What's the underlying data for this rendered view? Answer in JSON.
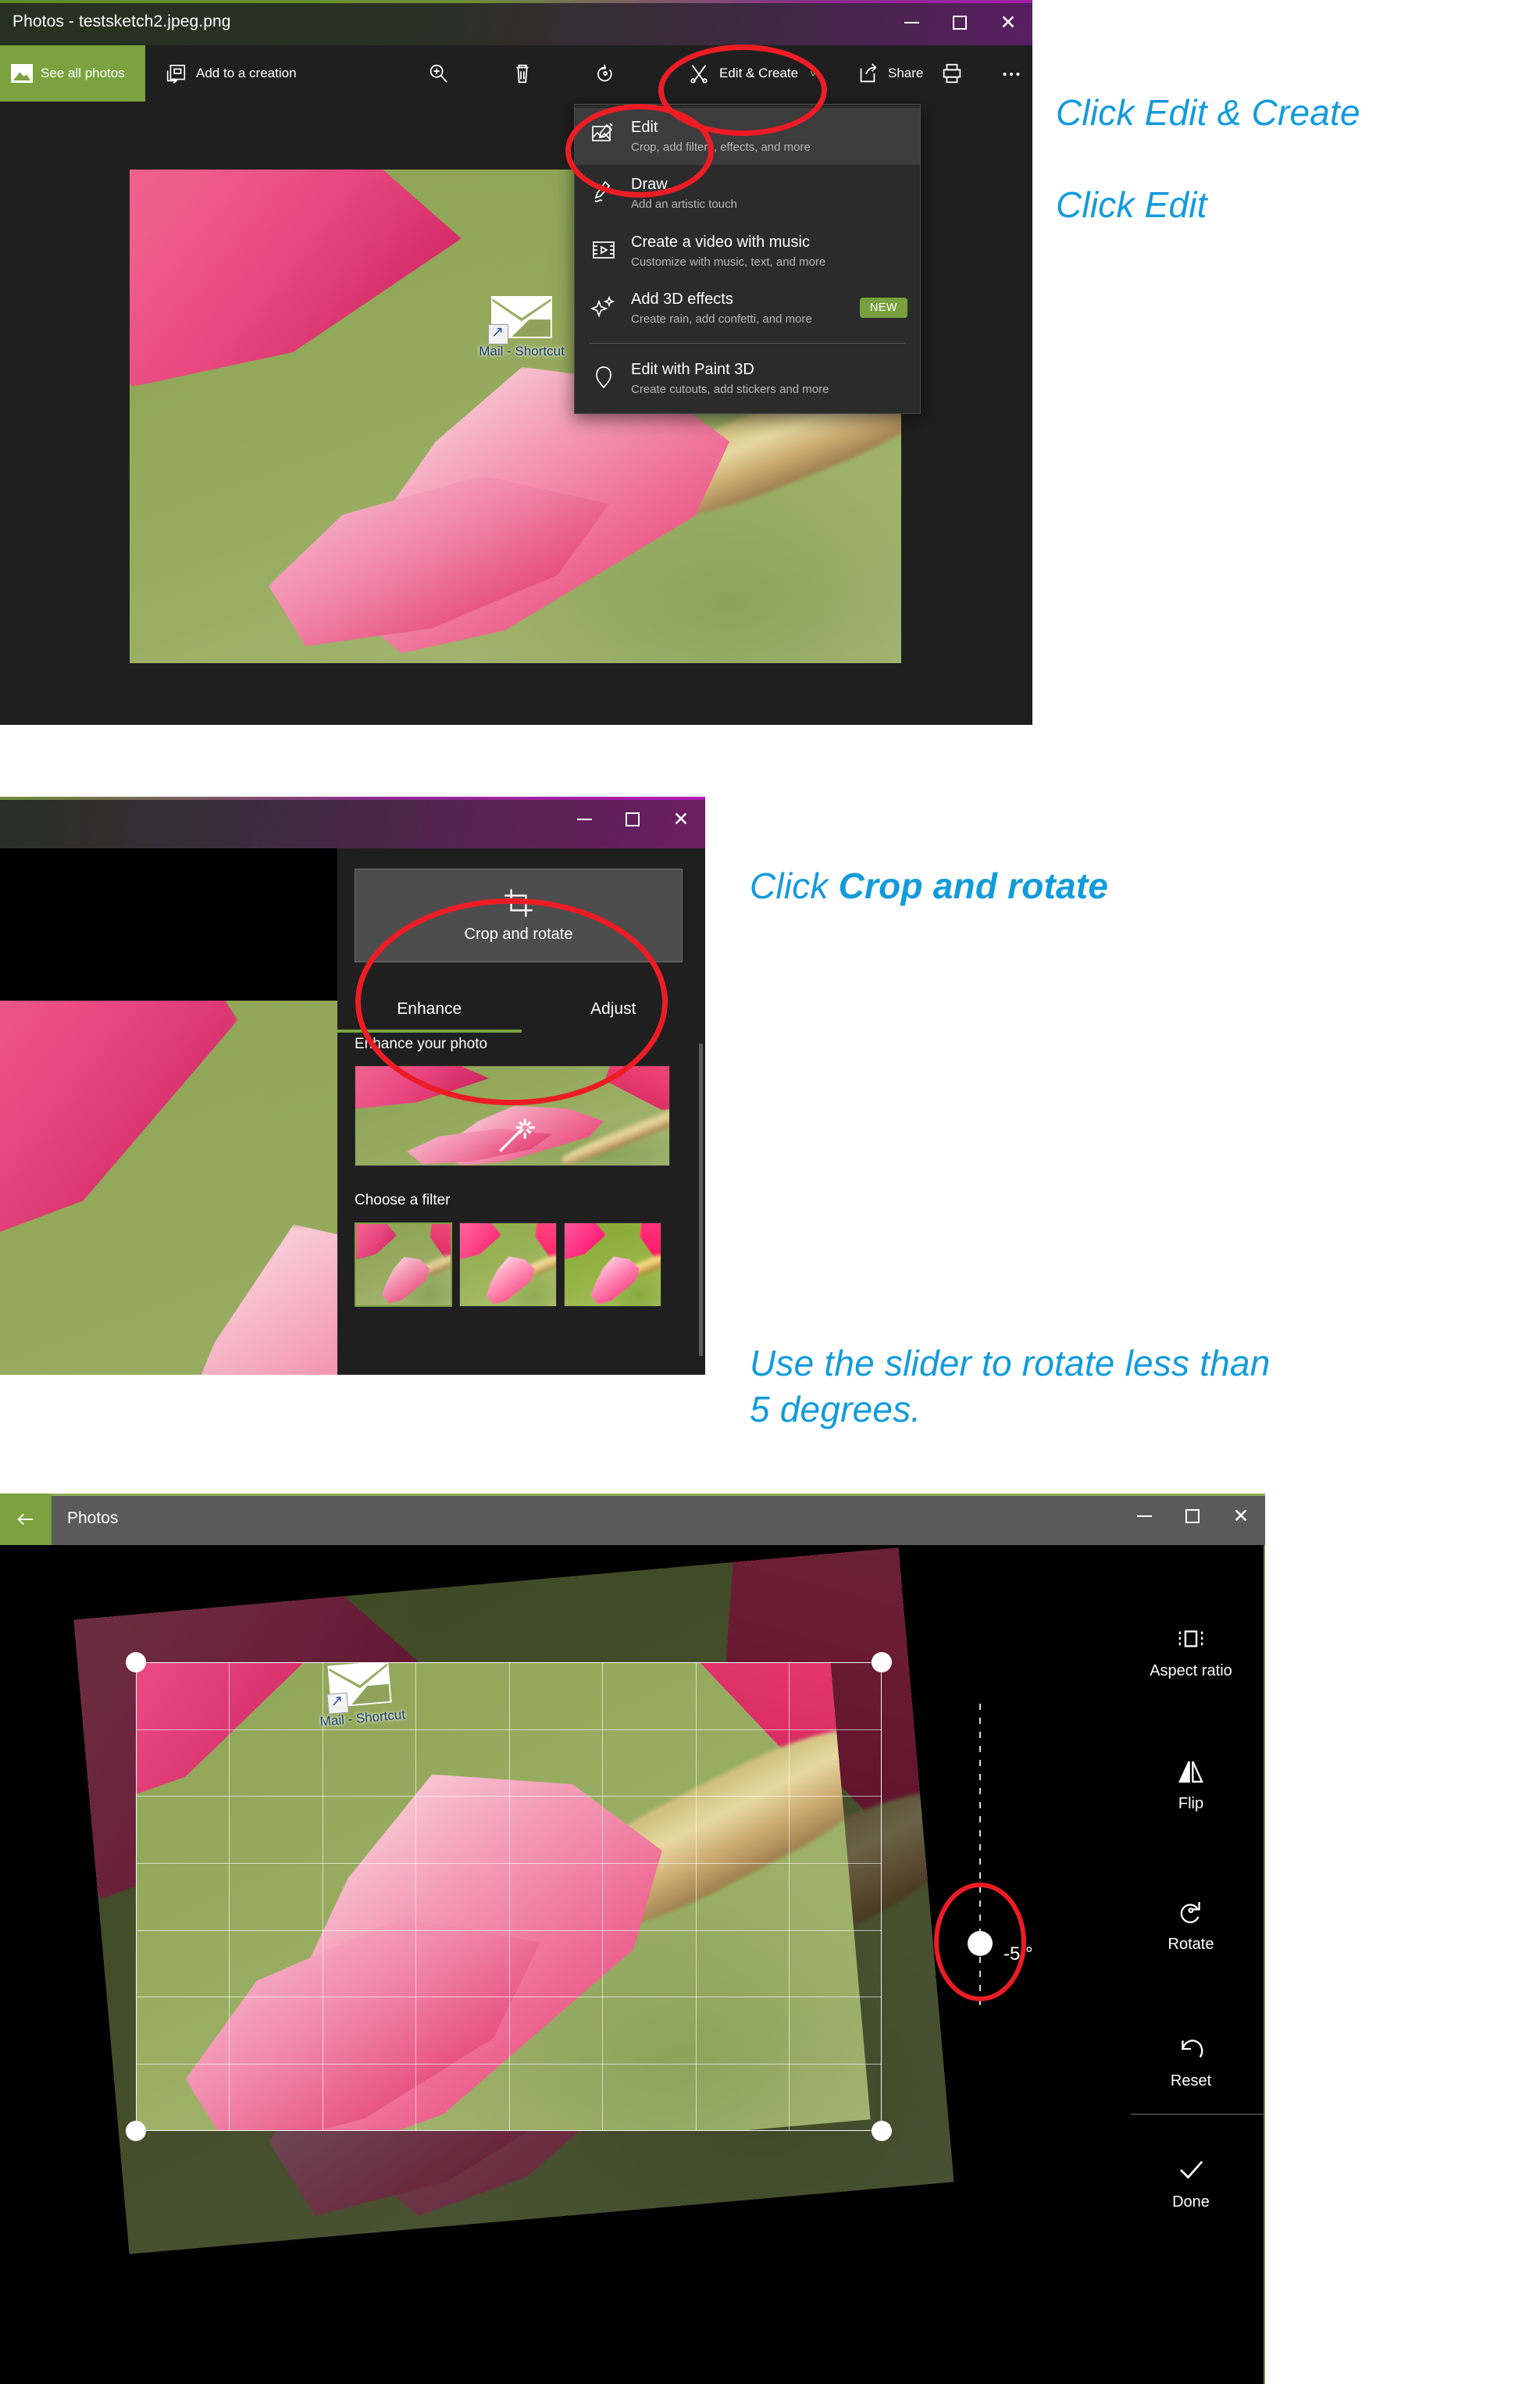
{
  "panel1": {
    "window_title": "Photos - testsketch2.jpeg.png",
    "window_controls": {
      "minimize": "minimize-icon",
      "maximize": "maximize-icon",
      "close": "close-icon"
    },
    "toolbar": {
      "see_all_photos": "See all photos",
      "add_to_creation": "Add to a creation",
      "zoom_icon": "zoom-in-icon",
      "delete_icon": "trash-icon",
      "rotate_icon": "rotate-icon",
      "edit_create": "Edit & Create",
      "edit_create_chevron": "˅",
      "share": "Share",
      "print_icon": "print-icon",
      "more_icon": "ellipsis-icon"
    },
    "menu": {
      "items": [
        {
          "title": "Edit",
          "subtitle": "Crop, add filters, effects, and more",
          "icon": "edit-image-icon",
          "selected": true,
          "badge": ""
        },
        {
          "title": "Draw",
          "subtitle": "Add an artistic touch",
          "icon": "pen-icon",
          "selected": false,
          "badge": ""
        },
        {
          "title": "Create a video with music",
          "subtitle": "Customize with music, text, and more",
          "icon": "film-icon",
          "selected": false,
          "badge": ""
        },
        {
          "title": "Add 3D effects",
          "subtitle": "Create rain, add confetti, and more",
          "icon": "sparkle-icon",
          "selected": false,
          "badge": "NEW"
        },
        {
          "title": "Edit with Paint 3D",
          "subtitle": "Create cutouts, add stickers and more",
          "icon": "paint3d-icon",
          "selected": false,
          "badge": ""
        }
      ]
    },
    "photo": {
      "desktop_icon_label": "Mail -\nShortcut"
    }
  },
  "panel2": {
    "window_controls": {
      "minimize": "minimize-icon",
      "maximize": "maximize-icon",
      "close": "close-icon"
    },
    "crop_button": {
      "label": "Crop and rotate",
      "icon": "crop-icon"
    },
    "tabs": [
      {
        "label": "Enhance",
        "active": true
      },
      {
        "label": "Adjust",
        "active": false
      }
    ],
    "enhance_section_title": "Enhance your photo",
    "enhance_thumb_icon": "magic-wand-icon",
    "filter_section_title": "Choose a filter",
    "filters": [
      {
        "name": "filter-thumbnail-1",
        "selected": true
      },
      {
        "name": "filter-thumbnail-2",
        "selected": false
      },
      {
        "name": "filter-thumbnail-3",
        "selected": false
      }
    ]
  },
  "panel3": {
    "back_icon": "back-arrow-icon",
    "window_title": "Photos",
    "window_controls": {
      "minimize": "minimize-icon",
      "maximize": "maximize-icon",
      "close": "close-icon"
    },
    "tools": [
      {
        "label": "Aspect ratio",
        "icon": "aspect-ratio-icon"
      },
      {
        "label": "Flip",
        "icon": "flip-icon"
      },
      {
        "label": "Rotate",
        "icon": "rotate-icon"
      },
      {
        "label": "Reset",
        "icon": "reset-icon"
      },
      {
        "label": "Done",
        "icon": "check-icon"
      }
    ],
    "slider": {
      "value": "-5 °",
      "handle": "rotation-slider-handle"
    },
    "photo": {
      "desktop_icon_label": "Mail -\nShortcut"
    }
  },
  "annotations": {
    "colors": {
      "callout": "#129bdb",
      "highlight": "#ed1c24",
      "accent_green": "#7ba23f"
    },
    "a1_line1": "Click Edit &  Create",
    "a1_line2": "Click Edit",
    "a2_prefix": "Click ",
    "a2_bold": "Crop and rotate",
    "a3": "Use the slider to rotate less than\n5 degrees."
  }
}
